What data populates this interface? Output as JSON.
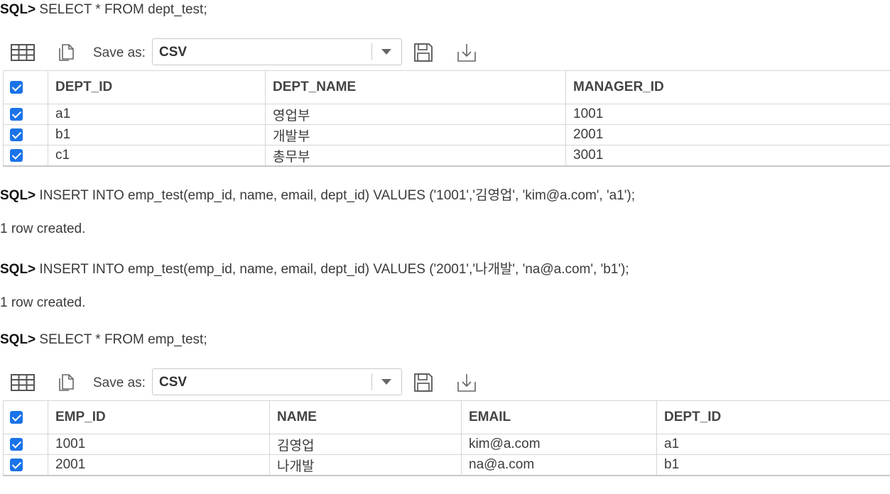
{
  "log": {
    "cmd1": {
      "prompt": "SQL>",
      "text": " SELECT * FROM dept_test;"
    },
    "cmd2": {
      "prompt": "SQL>",
      "text": " INSERT INTO emp_test(emp_id, name, email, dept_id) VALUES ('1001','김영업', 'kim@a.com', 'a1');"
    },
    "msg2": "1 row created.",
    "cmd3": {
      "prompt": "SQL>",
      "text": " INSERT INTO emp_test(emp_id, name, email, dept_id) VALUES ('2001','나개발', 'na@a.com', 'b1');"
    },
    "msg3": "1 row created.",
    "cmd4": {
      "prompt": "SQL>",
      "text": " SELECT * FROM emp_test;"
    }
  },
  "toolbar": {
    "grid_icon": "table-grid-icon",
    "copy_icon": "copy-icon",
    "save_as_label": "Save as:",
    "format_value": "CSV",
    "save_icon": "floppy-save-icon",
    "download_icon": "download-icon"
  },
  "result1": {
    "columns": [
      "DEPT_ID",
      "DEPT_NAME",
      "MANAGER_ID"
    ],
    "rows": [
      [
        "a1",
        "영업부",
        "1001"
      ],
      [
        "b1",
        "개발부",
        "2001"
      ],
      [
        "c1",
        "총무부",
        "3001"
      ]
    ]
  },
  "result2": {
    "columns": [
      "EMP_ID",
      "NAME",
      "EMAIL",
      "DEPT_ID"
    ],
    "rows": [
      [
        "1001",
        "김영업",
        "kim@a.com",
        "a1"
      ],
      [
        "2001",
        "나개발",
        "na@a.com",
        "b1"
      ]
    ]
  },
  "colors": {
    "checkbox": "#1a73e8",
    "border": "#d6d6d6"
  }
}
